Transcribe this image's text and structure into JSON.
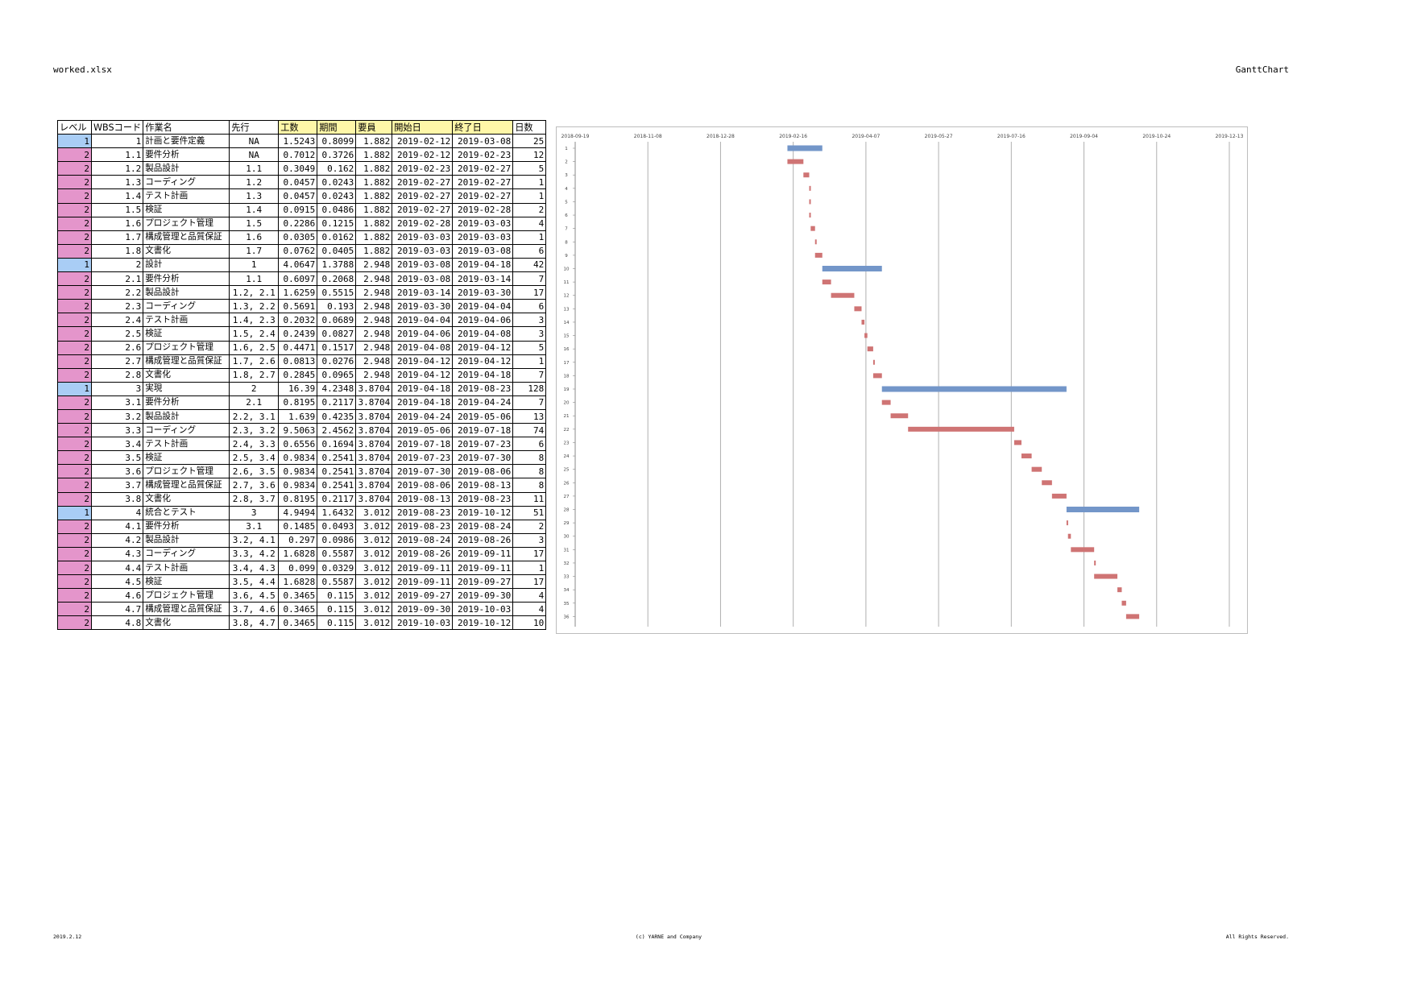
{
  "header": {
    "filename": "worked.xlsx",
    "sheet": "GanttChart"
  },
  "footer": {
    "date": "2019.2.12",
    "copyright": "(c) YARNE and Company",
    "rights": "All Rights Reserved."
  },
  "table": {
    "headers": [
      "レベル",
      "WBSコード",
      "作業名",
      "先行",
      "工数",
      "期間",
      "要員",
      "開始日",
      "終了日",
      "日数"
    ],
    "rows": [
      [
        "1",
        "1",
        "計画と要件定義",
        "NA",
        "1.5243",
        "0.8099",
        "1.882",
        "2019-02-12",
        "2019-03-08",
        "25"
      ],
      [
        "2",
        "1.1",
        "要件分析",
        "NA",
        "0.7012",
        "0.3726",
        "1.882",
        "2019-02-12",
        "2019-02-23",
        "12"
      ],
      [
        "2",
        "1.2",
        "製品設計",
        "1.1",
        "0.3049",
        "0.162",
        "1.882",
        "2019-02-23",
        "2019-02-27",
        "5"
      ],
      [
        "2",
        "1.3",
        "コーディング",
        "1.2",
        "0.0457",
        "0.0243",
        "1.882",
        "2019-02-27",
        "2019-02-27",
        "1"
      ],
      [
        "2",
        "1.4",
        "テスト計画",
        "1.3",
        "0.0457",
        "0.0243",
        "1.882",
        "2019-02-27",
        "2019-02-27",
        "1"
      ],
      [
        "2",
        "1.5",
        "検証",
        "1.4",
        "0.0915",
        "0.0486",
        "1.882",
        "2019-02-27",
        "2019-02-28",
        "2"
      ],
      [
        "2",
        "1.6",
        "プロジェクト管理",
        "1.5",
        "0.2286",
        "0.1215",
        "1.882",
        "2019-02-28",
        "2019-03-03",
        "4"
      ],
      [
        "2",
        "1.7",
        "構成管理と品質保証",
        "1.6",
        "0.0305",
        "0.0162",
        "1.882",
        "2019-03-03",
        "2019-03-03",
        "1"
      ],
      [
        "2",
        "1.8",
        "文書化",
        "1.7",
        "0.0762",
        "0.0405",
        "1.882",
        "2019-03-03",
        "2019-03-08",
        "6"
      ],
      [
        "1",
        "2",
        "設計",
        "1",
        "4.0647",
        "1.3788",
        "2.948",
        "2019-03-08",
        "2019-04-18",
        "42"
      ],
      [
        "2",
        "2.1",
        "要件分析",
        "1.1",
        "0.6097",
        "0.2068",
        "2.948",
        "2019-03-08",
        "2019-03-14",
        "7"
      ],
      [
        "2",
        "2.2",
        "製品設計",
        "1.2, 2.1",
        "1.6259",
        "0.5515",
        "2.948",
        "2019-03-14",
        "2019-03-30",
        "17"
      ],
      [
        "2",
        "2.3",
        "コーディング",
        "1.3, 2.2",
        "0.5691",
        "0.193",
        "2.948",
        "2019-03-30",
        "2019-04-04",
        "6"
      ],
      [
        "2",
        "2.4",
        "テスト計画",
        "1.4, 2.3",
        "0.2032",
        "0.0689",
        "2.948",
        "2019-04-04",
        "2019-04-06",
        "3"
      ],
      [
        "2",
        "2.5",
        "検証",
        "1.5, 2.4",
        "0.2439",
        "0.0827",
        "2.948",
        "2019-04-06",
        "2019-04-08",
        "3"
      ],
      [
        "2",
        "2.6",
        "プロジェクト管理",
        "1.6, 2.5",
        "0.4471",
        "0.1517",
        "2.948",
        "2019-04-08",
        "2019-04-12",
        "5"
      ],
      [
        "2",
        "2.7",
        "構成管理と品質保証",
        "1.7, 2.6",
        "0.0813",
        "0.0276",
        "2.948",
        "2019-04-12",
        "2019-04-12",
        "1"
      ],
      [
        "2",
        "2.8",
        "文書化",
        "1.8, 2.7",
        "0.2845",
        "0.0965",
        "2.948",
        "2019-04-12",
        "2019-04-18",
        "7"
      ],
      [
        "1",
        "3",
        "実現",
        "2",
        "16.39",
        "4.2348",
        "3.8704",
        "2019-04-18",
        "2019-08-23",
        "128"
      ],
      [
        "2",
        "3.1",
        "要件分析",
        "2.1",
        "0.8195",
        "0.2117",
        "3.8704",
        "2019-04-18",
        "2019-04-24",
        "7"
      ],
      [
        "2",
        "3.2",
        "製品設計",
        "2.2, 3.1",
        "1.639",
        "0.4235",
        "3.8704",
        "2019-04-24",
        "2019-05-06",
        "13"
      ],
      [
        "2",
        "3.3",
        "コーディング",
        "2.3, 3.2",
        "9.5063",
        "2.4562",
        "3.8704",
        "2019-05-06",
        "2019-07-18",
        "74"
      ],
      [
        "2",
        "3.4",
        "テスト計画",
        "2.4, 3.3",
        "0.6556",
        "0.1694",
        "3.8704",
        "2019-07-18",
        "2019-07-23",
        "6"
      ],
      [
        "2",
        "3.5",
        "検証",
        "2.5, 3.4",
        "0.9834",
        "0.2541",
        "3.8704",
        "2019-07-23",
        "2019-07-30",
        "8"
      ],
      [
        "2",
        "3.6",
        "プロジェクト管理",
        "2.6, 3.5",
        "0.9834",
        "0.2541",
        "3.8704",
        "2019-07-30",
        "2019-08-06",
        "8"
      ],
      [
        "2",
        "3.7",
        "構成管理と品質保証",
        "2.7, 3.6",
        "0.9834",
        "0.2541",
        "3.8704",
        "2019-08-06",
        "2019-08-13",
        "8"
      ],
      [
        "2",
        "3.8",
        "文書化",
        "2.8, 3.7",
        "0.8195",
        "0.2117",
        "3.8704",
        "2019-08-13",
        "2019-08-23",
        "11"
      ],
      [
        "1",
        "4",
        "統合とテスト",
        "3",
        "4.9494",
        "1.6432",
        "3.012",
        "2019-08-23",
        "2019-10-12",
        "51"
      ],
      [
        "2",
        "4.1",
        "要件分析",
        "3.1",
        "0.1485",
        "0.0493",
        "3.012",
        "2019-08-23",
        "2019-08-24",
        "2"
      ],
      [
        "2",
        "4.2",
        "製品設計",
        "3.2, 4.1",
        "0.297",
        "0.0986",
        "3.012",
        "2019-08-24",
        "2019-08-26",
        "3"
      ],
      [
        "2",
        "4.3",
        "コーディング",
        "3.3, 4.2",
        "1.6828",
        "0.5587",
        "3.012",
        "2019-08-26",
        "2019-09-11",
        "17"
      ],
      [
        "2",
        "4.4",
        "テスト計画",
        "3.4, 4.3",
        "0.099",
        "0.0329",
        "3.012",
        "2019-09-11",
        "2019-09-11",
        "1"
      ],
      [
        "2",
        "4.5",
        "検証",
        "3.5, 4.4",
        "1.6828",
        "0.5587",
        "3.012",
        "2019-09-11",
        "2019-09-27",
        "17"
      ],
      [
        "2",
        "4.6",
        "プロジェクト管理",
        "3.6, 4.5",
        "0.3465",
        "0.115",
        "3.012",
        "2019-09-27",
        "2019-09-30",
        "4"
      ],
      [
        "2",
        "4.7",
        "構成管理と品質保証",
        "3.7, 4.6",
        "0.3465",
        "0.115",
        "3.012",
        "2019-09-30",
        "2019-10-03",
        "4"
      ],
      [
        "2",
        "4.8",
        "文書化",
        "3.8, 4.7",
        "0.3465",
        "0.115",
        "3.012",
        "2019-10-03",
        "2019-10-12",
        "10"
      ]
    ]
  },
  "colors": {
    "level1": "#a9cdf5",
    "level2": "#e495cb",
    "header_highlight": "#fff7a8",
    "bar_level1": "#7396c9",
    "bar_level2": "#cf7474"
  },
  "chart_data": {
    "type": "gantt",
    "x_tick_labels": [
      "2018-09-19",
      "2018-11-08",
      "2018-12-28",
      "2019-02-16",
      "2019-04-07",
      "2019-05-27",
      "2019-07-16",
      "2019-09-04",
      "2019-10-24",
      "2019-12-13"
    ],
    "row_labels": [
      "1",
      "2",
      "3",
      "4",
      "5",
      "6",
      "7",
      "8",
      "9",
      "10",
      "11",
      "12",
      "13",
      "14",
      "15",
      "16",
      "17",
      "18",
      "19",
      "20",
      "21",
      "22",
      "23",
      "24",
      "25",
      "26",
      "27",
      "28",
      "29",
      "30",
      "31",
      "32",
      "33",
      "34",
      "35",
      "36"
    ],
    "grid": true,
    "tasks": [
      {
        "level": 1,
        "start": "2019-02-12",
        "end": "2019-03-08"
      },
      {
        "level": 2,
        "start": "2019-02-12",
        "end": "2019-02-23"
      },
      {
        "level": 2,
        "start": "2019-02-23",
        "end": "2019-02-27"
      },
      {
        "level": 2,
        "start": "2019-02-27",
        "end": "2019-02-27"
      },
      {
        "level": 2,
        "start": "2019-02-27",
        "end": "2019-02-27"
      },
      {
        "level": 2,
        "start": "2019-02-27",
        "end": "2019-02-28"
      },
      {
        "level": 2,
        "start": "2019-02-28",
        "end": "2019-03-03"
      },
      {
        "level": 2,
        "start": "2019-03-03",
        "end": "2019-03-03"
      },
      {
        "level": 2,
        "start": "2019-03-03",
        "end": "2019-03-08"
      },
      {
        "level": 1,
        "start": "2019-03-08",
        "end": "2019-04-18"
      },
      {
        "level": 2,
        "start": "2019-03-08",
        "end": "2019-03-14"
      },
      {
        "level": 2,
        "start": "2019-03-14",
        "end": "2019-03-30"
      },
      {
        "level": 2,
        "start": "2019-03-30",
        "end": "2019-04-04"
      },
      {
        "level": 2,
        "start": "2019-04-04",
        "end": "2019-04-06"
      },
      {
        "level": 2,
        "start": "2019-04-06",
        "end": "2019-04-08"
      },
      {
        "level": 2,
        "start": "2019-04-08",
        "end": "2019-04-12"
      },
      {
        "level": 2,
        "start": "2019-04-12",
        "end": "2019-04-12"
      },
      {
        "level": 2,
        "start": "2019-04-12",
        "end": "2019-04-18"
      },
      {
        "level": 1,
        "start": "2019-04-18",
        "end": "2019-08-23"
      },
      {
        "level": 2,
        "start": "2019-04-18",
        "end": "2019-04-24"
      },
      {
        "level": 2,
        "start": "2019-04-24",
        "end": "2019-05-06"
      },
      {
        "level": 2,
        "start": "2019-05-06",
        "end": "2019-07-18"
      },
      {
        "level": 2,
        "start": "2019-07-18",
        "end": "2019-07-23"
      },
      {
        "level": 2,
        "start": "2019-07-23",
        "end": "2019-07-30"
      },
      {
        "level": 2,
        "start": "2019-07-30",
        "end": "2019-08-06"
      },
      {
        "level": 2,
        "start": "2019-08-06",
        "end": "2019-08-13"
      },
      {
        "level": 2,
        "start": "2019-08-13",
        "end": "2019-08-23"
      },
      {
        "level": 1,
        "start": "2019-08-23",
        "end": "2019-10-12"
      },
      {
        "level": 2,
        "start": "2019-08-23",
        "end": "2019-08-24"
      },
      {
        "level": 2,
        "start": "2019-08-24",
        "end": "2019-08-26"
      },
      {
        "level": 2,
        "start": "2019-08-26",
        "end": "2019-09-11"
      },
      {
        "level": 2,
        "start": "2019-09-11",
        "end": "2019-09-11"
      },
      {
        "level": 2,
        "start": "2019-09-11",
        "end": "2019-09-27"
      },
      {
        "level": 2,
        "start": "2019-09-27",
        "end": "2019-09-30"
      },
      {
        "level": 2,
        "start": "2019-09-30",
        "end": "2019-10-03"
      },
      {
        "level": 2,
        "start": "2019-10-03",
        "end": "2019-10-12"
      }
    ]
  }
}
